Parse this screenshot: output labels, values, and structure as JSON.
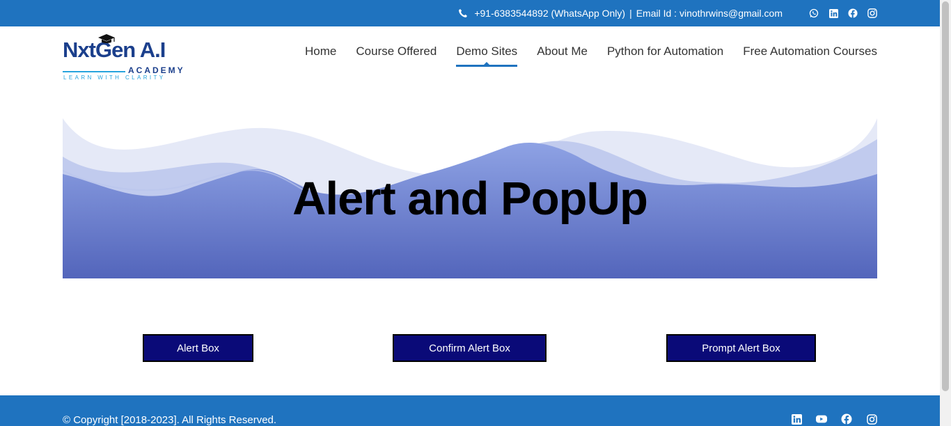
{
  "topbar": {
    "phone": "+91-6383544892 (WhatsApp Only)",
    "separator": "|",
    "email": "Email Id : vinothrwins@gmail.com",
    "social_icons": [
      "whatsapp-icon",
      "linkedin-icon",
      "facebook-icon",
      "instagram-icon"
    ],
    "background": "#1f73bf"
  },
  "logo": {
    "main": "NxtGen A.I",
    "sub": "ACADEMY",
    "tagline": "LEARN WITH CLARITY"
  },
  "nav": {
    "items": [
      {
        "label": "Home"
      },
      {
        "label": "Course Offered"
      },
      {
        "label": "Demo Sites",
        "active": true
      },
      {
        "label": "About Me"
      },
      {
        "label": "Python for Automation"
      },
      {
        "label": "Free Automation Courses"
      }
    ],
    "active_color": "#1f73bf"
  },
  "hero": {
    "title": "Alert and PopUp"
  },
  "buttons": {
    "alert": "Alert Box",
    "confirm": "Confirm Alert Box",
    "prompt": "Prompt Alert Box",
    "background": "#0a0a78"
  },
  "footer": {
    "copyright": "© Copyright [2018-2023]. All Rights Reserved.",
    "social_icons": [
      "linkedin-icon",
      "youtube-icon",
      "facebook-icon",
      "instagram-icon"
    ]
  }
}
